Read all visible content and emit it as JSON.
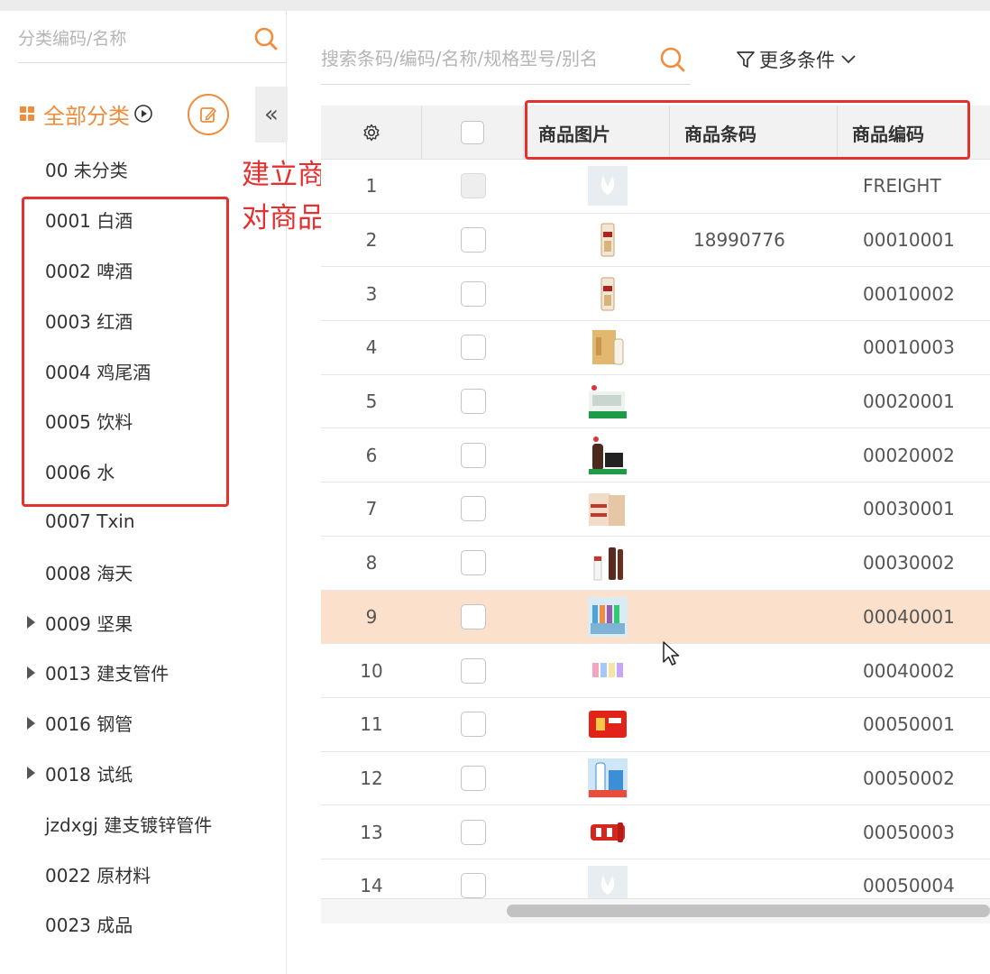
{
  "sidebar": {
    "search_placeholder": "分类编码/名称",
    "all_label": "全部分类",
    "collapse_glyph": "«",
    "items": [
      {
        "label": "00 未分类",
        "expandable": false
      },
      {
        "label": "0001 白酒",
        "expandable": false
      },
      {
        "label": "0002 啤酒",
        "expandable": false
      },
      {
        "label": "0003 红酒",
        "expandable": false
      },
      {
        "label": "0004 鸡尾酒",
        "expandable": false
      },
      {
        "label": "0005 饮料",
        "expandable": false
      },
      {
        "label": "0006 水",
        "expandable": false
      },
      {
        "label": "0007 Txin",
        "expandable": false
      },
      {
        "label": "0008 海天",
        "expandable": false
      },
      {
        "label": "0009 坚果",
        "expandable": true
      },
      {
        "label": "0013 建支管件",
        "expandable": true
      },
      {
        "label": "0016 钢管",
        "expandable": true
      },
      {
        "label": "0018 试纸",
        "expandable": true
      },
      {
        "label": "jzdxgj 建支镀锌管件",
        "expandable": false
      },
      {
        "label": "0022 原材料",
        "expandable": false
      },
      {
        "label": "0023 成品",
        "expandable": false
      }
    ]
  },
  "annotation": {
    "line1": "建立商品档案",
    "line2": "对商品进行分类"
  },
  "toolbar": {
    "search_placeholder": "搜索条码/编码/名称/规格型号/别名",
    "more_filters_label": "更多条件"
  },
  "table": {
    "columns": {
      "image": "商品图片",
      "barcode": "商品条码",
      "code": "商品编码"
    },
    "rows": [
      {
        "index": "1",
        "image": "placeholder",
        "barcode": "",
        "code": "FREIGHT",
        "disabled": true
      },
      {
        "index": "2",
        "image": "baijiu",
        "barcode": "18990776",
        "code": "00010001"
      },
      {
        "index": "3",
        "image": "baijiu",
        "barcode": "",
        "code": "00010002"
      },
      {
        "index": "4",
        "image": "giftbox",
        "barcode": "",
        "code": "00010003"
      },
      {
        "index": "5",
        "image": "beer-pack",
        "barcode": "",
        "code": "00020001"
      },
      {
        "index": "6",
        "image": "beer-bottle",
        "barcode": "",
        "code": "00020002"
      },
      {
        "index": "7",
        "image": "wine-box",
        "barcode": "",
        "code": "00030001"
      },
      {
        "index": "8",
        "image": "wine-bottles",
        "barcode": "",
        "code": "00030002"
      },
      {
        "index": "9",
        "image": "cocktail-pack",
        "barcode": "",
        "code": "00040001",
        "highlighted": true
      },
      {
        "index": "10",
        "image": "cocktail-cans",
        "barcode": "",
        "code": "00040002"
      },
      {
        "index": "11",
        "image": "drink-red",
        "barcode": "",
        "code": "00050001"
      },
      {
        "index": "12",
        "image": "drink-blue",
        "barcode": "",
        "code": "00050002"
      },
      {
        "index": "13",
        "image": "drink-cans",
        "barcode": "",
        "code": "00050003"
      },
      {
        "index": "14",
        "image": "placeholder",
        "barcode": "",
        "code": "00050004"
      }
    ]
  },
  "colors": {
    "accent": "#f08d3c",
    "annotation_red": "#e53030",
    "row_highlight": "#fbe0cb"
  }
}
